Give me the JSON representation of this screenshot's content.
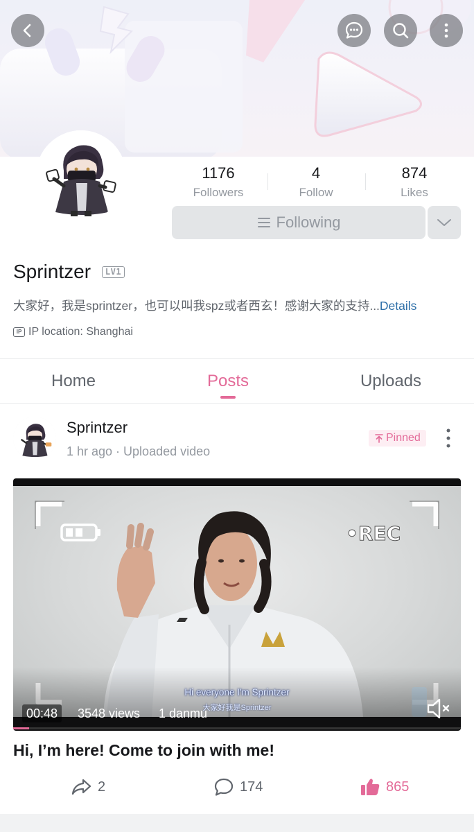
{
  "header": {
    "back_icon": "back-arrow-icon",
    "message_icon": "chat-bubble-icon",
    "search_icon": "search-icon",
    "more_icon": "vertical-dots-icon"
  },
  "profile": {
    "stats": [
      {
        "value": "1176",
        "label": "Followers"
      },
      {
        "value": "4",
        "label": "Follow"
      },
      {
        "value": "874",
        "label": "Likes"
      }
    ],
    "follow_button_label": "Following",
    "username": "Sprintzer",
    "level_badge": "LV1",
    "bio": "大家好，我是sprintzer，也可以叫我spz或者西玄！感谢大家的支持...",
    "bio_more_label": "Details",
    "ip_badge": "IP",
    "ip_location": "IP location: Shanghai"
  },
  "tabs": [
    {
      "label": "Home",
      "active": false
    },
    {
      "label": "Posts",
      "active": true
    },
    {
      "label": "Uploads",
      "active": false
    }
  ],
  "post": {
    "author": "Sprintzer",
    "meta": "1 hr ago · Uploaded video",
    "pinned_label": "Pinned",
    "video": {
      "duration": "00:48",
      "views": "3548 views",
      "danmu": "1 danmu",
      "subtitle_en": "Hi everyone I'm Sprintzer",
      "subtitle_cn": "大家好我是Sprintzer",
      "overlay_text": "•REC",
      "progress_fraction": 0.035
    },
    "title": "Hi, I’m here! Come to join with me!",
    "actions": {
      "shares": "2",
      "comments": "174",
      "likes": "865"
    }
  },
  "colors": {
    "accent": "#e36a98",
    "link": "#2d6fa8",
    "muted_text": "#9499a0",
    "button_bg": "#e3e5e7"
  }
}
